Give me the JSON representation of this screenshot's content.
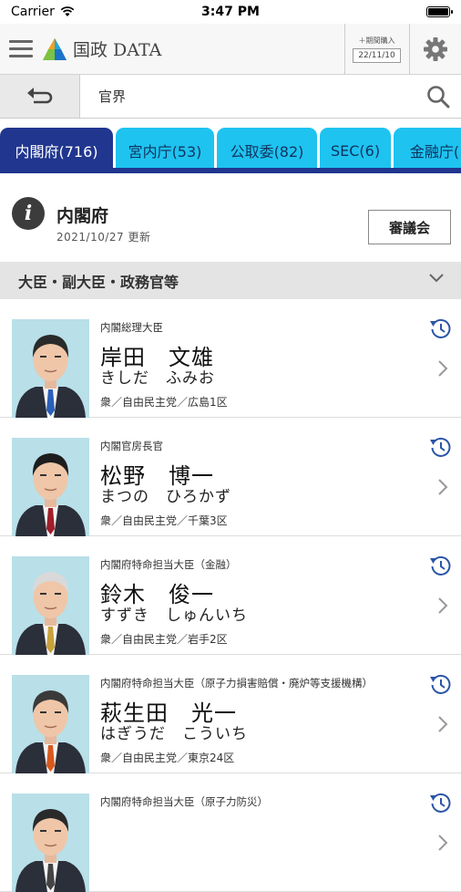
{
  "status": {
    "carrier": "Carrier",
    "time": "3:47 PM"
  },
  "header": {
    "app_title": "国政 DATA",
    "update_label": "＋期間購入",
    "update_date": "22/11/10"
  },
  "search": {
    "back_icon": "return-arrow-icon",
    "value": "官界"
  },
  "tabs": [
    {
      "label": "内閣府(716)",
      "active": true
    },
    {
      "label": "宮内庁(53)",
      "active": false
    },
    {
      "label": "公取委(82)",
      "active": false
    },
    {
      "label": "SEC(6)",
      "active": false
    },
    {
      "label": "金融庁(",
      "active": false
    }
  ],
  "ministry": {
    "name": "内閣府",
    "updated": "2021/10/27 更新",
    "council_button": "審議会"
  },
  "section": {
    "title": "大臣・副大臣・政務官等"
  },
  "officials": [
    {
      "post": "内閣総理大臣",
      "name": "岸田　文雄",
      "kana": "きしだ　ふみお",
      "affiliation": "衆／自由民主党／広島1区",
      "tie": "#2b5fb8",
      "hair": "#2a2a2a"
    },
    {
      "post": "内閣官房長官",
      "name": "松野　博一",
      "kana": "まつの　ひろかず",
      "affiliation": "衆／自由民主党／千葉3区",
      "tie": "#a01e2a",
      "hair": "#1d1d1d"
    },
    {
      "post": "内閣府特命担当大臣（金融）",
      "name": "鈴木　俊一",
      "kana": "すずき　しゅんいち",
      "affiliation": "衆／自由民主党／岩手2区",
      "tie": "#c8a23a",
      "hair": "#d9d9d9"
    },
    {
      "post": "内閣府特命担当大臣（原子力損害賠償・廃炉等支援機構）",
      "name": "萩生田　光一",
      "kana": "はぎうだ　こういち",
      "affiliation": "衆／自由民主党／東京24区",
      "tie": "#d9591e",
      "hair": "#3a3a3a"
    },
    {
      "post": "内閣府特命担当大臣（原子力防災）",
      "name": "",
      "kana": "",
      "affiliation": "",
      "tie": "#444",
      "hair": "#2a2a2a"
    }
  ],
  "colors": {
    "tab_active": "#20368f",
    "tab": "#1ec3f0",
    "icon_blue": "#2a55a8"
  }
}
